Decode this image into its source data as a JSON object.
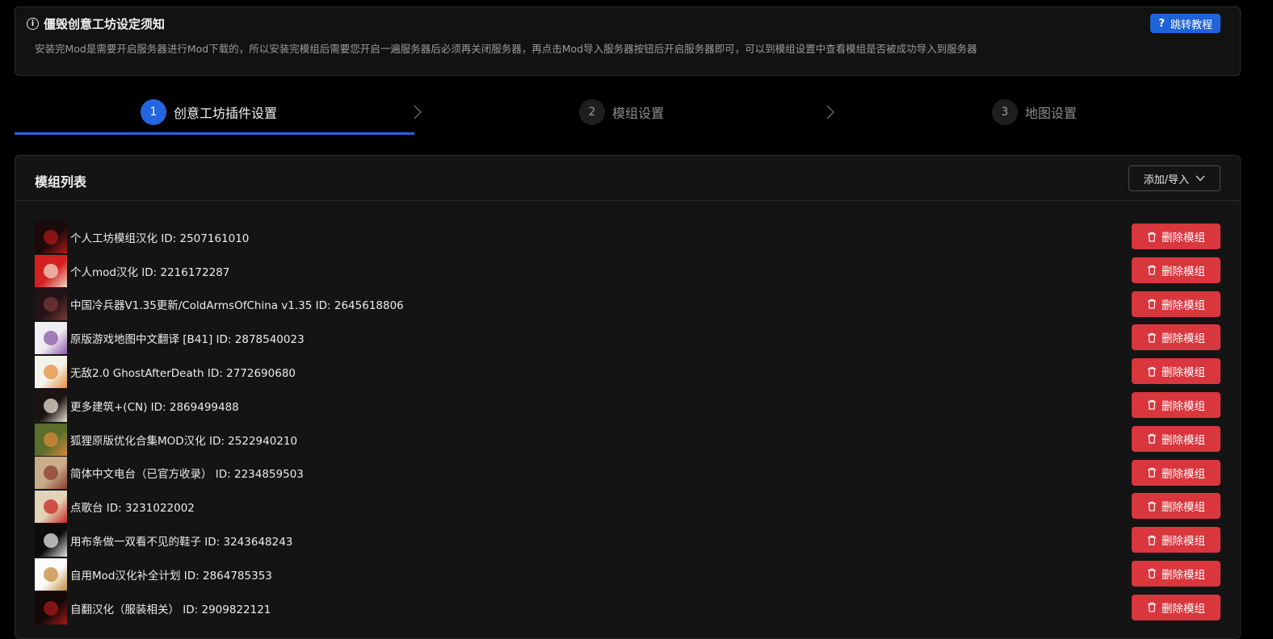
{
  "notice": {
    "title": "僵毁创意工坊设定须知",
    "description": "安装完Mod是需要开启服务器进行Mod下载的，所以安装完模组后需要您开启一遍服务器后必须再关闭服务器，再点击Mod导入服务器按钮后开启服务器即可，可以到模组设置中查看模组是否被成功导入到服务器",
    "tutorial_button": "跳转教程",
    "info_icon": "info-icon",
    "help_icon": "question-icon"
  },
  "steps": [
    {
      "number": "1",
      "label": "创意工坊插件设置",
      "active": true
    },
    {
      "number": "2",
      "label": "模组设置",
      "active": false
    },
    {
      "number": "3",
      "label": "地图设置",
      "active": false
    }
  ],
  "panel": {
    "title": "模组列表",
    "add_button": "添加/导入"
  },
  "delete_label": "删除模组",
  "mods": [
    {
      "name": "个人工坊模组汉化 ID: 2507161010",
      "thumb_color": "#1a0a0a",
      "thumb_accent": "#b01818"
    },
    {
      "name": "个人mod汉化 ID: 2216172287",
      "thumb_color": "#d42020",
      "thumb_accent": "#f3d6c6"
    },
    {
      "name": "中国冷兵器V1.35更新/ColdArmsOfChina v1.35 ID: 2645618806",
      "thumb_color": "#231316",
      "thumb_accent": "#7a3838"
    },
    {
      "name": "原版游戏地图中文翻译 [B41] ID: 2878540023",
      "thumb_color": "#f1eef3",
      "thumb_accent": "#8a58a8"
    },
    {
      "name": "无敌2.0 GhostAfterDeath ID: 2772690680",
      "thumb_color": "#f2f4ec",
      "thumb_accent": "#e58e3a"
    },
    {
      "name": "更多建筑+(CN) ID: 2869499488",
      "thumb_color": "#1b1412",
      "thumb_accent": "#e8e3d6"
    },
    {
      "name": "狐狸原版优化合集MOD汉化 ID: 2522940210",
      "thumb_color": "#5b6e2c",
      "thumb_accent": "#d9893a"
    },
    {
      "name": "简体中文电台（已官方收录） ID: 2234859503",
      "thumb_color": "#c9ad8a",
      "thumb_accent": "#8b3c2c"
    },
    {
      "name": "点歌台 ID: 3231022002",
      "thumb_color": "#e2d4b9",
      "thumb_accent": "#c8261f"
    },
    {
      "name": "用布条做一双看不见的鞋子 ID: 3243648243",
      "thumb_color": "#0c0c0c",
      "thumb_accent": "#e8e8e8"
    },
    {
      "name": "自用Mod汉化补全计划 ID: 2864785353",
      "thumb_color": "#fbfbfb",
      "thumb_accent": "#c28a3a"
    },
    {
      "name": "自翻汉化（服装相关） ID: 2909822121",
      "thumb_color": "#140808",
      "thumb_accent": "#a61818"
    }
  ]
}
